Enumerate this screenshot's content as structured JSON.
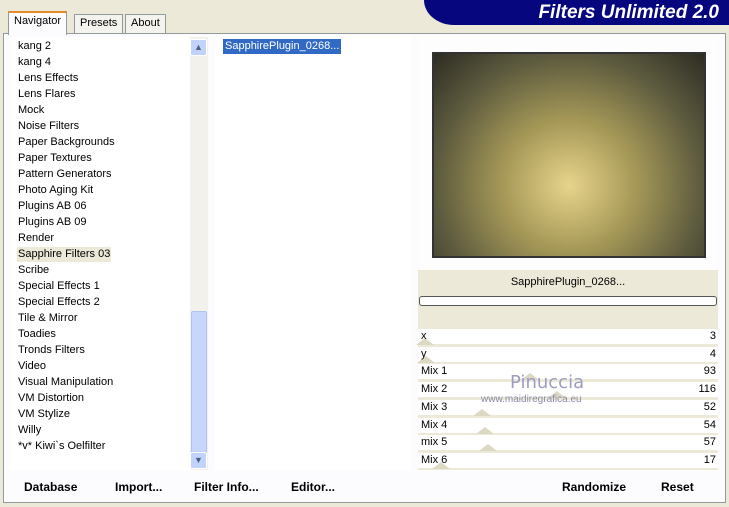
{
  "title": "Filters Unlimited 2.0",
  "tabs": [
    {
      "label": "Navigator"
    },
    {
      "label": "Presets"
    },
    {
      "label": "About"
    }
  ],
  "categories": [
    "kang 2",
    "kang 4",
    "Lens Effects",
    "Lens Flares",
    "Mock",
    "Noise Filters",
    "Paper Backgrounds",
    "Paper Textures",
    "Pattern Generators",
    "Photo Aging Kit",
    "Plugins AB 06",
    "Plugins AB 09",
    "Render",
    "Sapphire Filters 03",
    "Scribe",
    "Special Effects 1",
    "Special Effects 2",
    "Tile & Mirror",
    "Toadies",
    "Tronds Filters",
    "Video",
    "Visual Manipulation",
    "VM Distortion",
    "VM Stylize",
    "Willy",
    "*v* Kiwi`s Oelfilter"
  ],
  "selected_category": "Sapphire Filters 03",
  "filters": [
    "SapphirePlugin_0268..."
  ],
  "preview_label": "SapphirePlugin_0268...",
  "progress": 0,
  "params": [
    {
      "label": "x",
      "value": 3
    },
    {
      "label": "y",
      "value": 4
    },
    {
      "label": "Mix 1",
      "value": 93
    },
    {
      "label": "Mix 2",
      "value": 116
    },
    {
      "label": "Mix 3",
      "value": 52
    },
    {
      "label": "Mix 4",
      "value": 54
    },
    {
      "label": "mix 5",
      "value": 57
    },
    {
      "label": "Mix 6",
      "value": 17
    }
  ],
  "watermark": {
    "name": "Pinuccia",
    "url": "www.maidiregrafica.eu"
  },
  "buttons": {
    "database": "Database",
    "import": "Import...",
    "filter_info": "Filter Info...",
    "editor": "Editor...",
    "randomize": "Randomize",
    "reset": "Reset"
  }
}
